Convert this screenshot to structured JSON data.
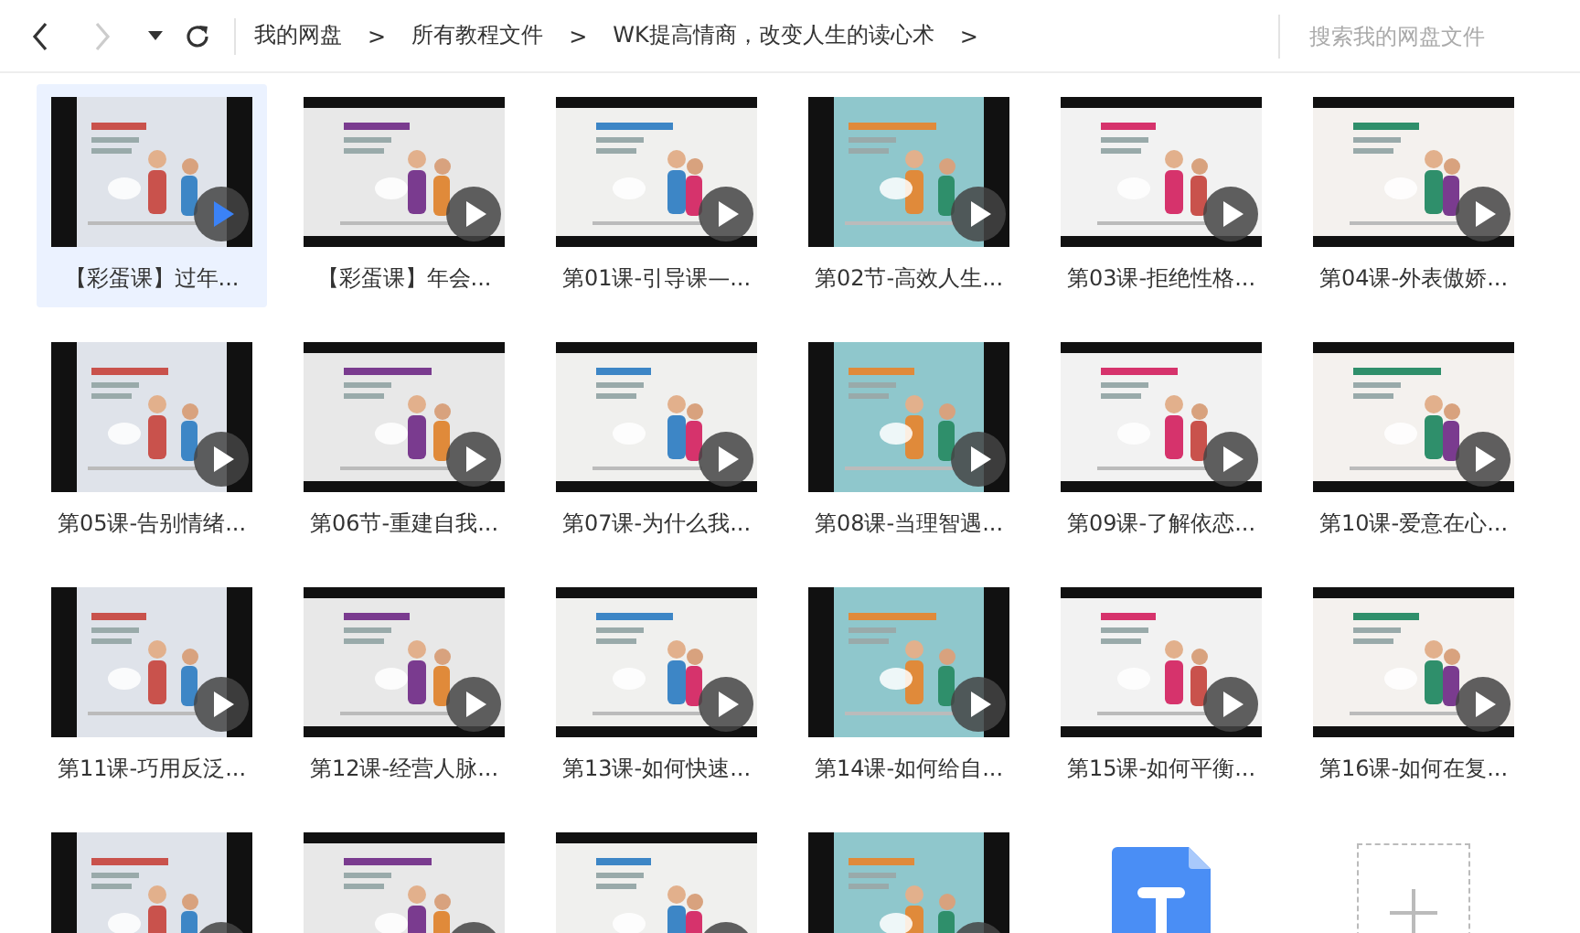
{
  "toolbar": {
    "nav": [
      {
        "kind": "back",
        "disabled": false
      },
      {
        "kind": "forward",
        "disabled": true
      },
      {
        "kind": "dropdown",
        "disabled": false
      },
      {
        "kind": "refresh",
        "disabled": false
      }
    ],
    "breadcrumbs": [
      {
        "label": "我的网盘",
        "sep": ">"
      },
      {
        "label": "所有教程文件",
        "sep": ">"
      },
      {
        "label": "WK提高情商，改变人生的读心术",
        "sep": ">"
      }
    ],
    "search": {
      "placeholder": "搜索我的网盘文件"
    }
  },
  "files": [
    {
      "kind": "video",
      "label": "【彩蛋课】过年...",
      "selected": true
    },
    {
      "kind": "video",
      "label": "【彩蛋课】年会...",
      "selected": false
    },
    {
      "kind": "video",
      "label": "第01课-引导课—...",
      "selected": false
    },
    {
      "kind": "video",
      "label": "第02节-高效人生...",
      "selected": false
    },
    {
      "kind": "video",
      "label": "第03课-拒绝性格...",
      "selected": false
    },
    {
      "kind": "video",
      "label": "第04课-外表傲娇...",
      "selected": false
    },
    {
      "kind": "video",
      "label": "第05课-告别情绪...",
      "selected": false
    },
    {
      "kind": "video",
      "label": "第06节-重建自我...",
      "selected": false
    },
    {
      "kind": "video",
      "label": "第07课-为什么我...",
      "selected": false
    },
    {
      "kind": "video",
      "label": "第08课-当理智遇...",
      "selected": false
    },
    {
      "kind": "video",
      "label": "第09课-了解依恋...",
      "selected": false
    },
    {
      "kind": "video",
      "label": "第10课-爱意在心...",
      "selected": false
    },
    {
      "kind": "video",
      "label": "第11课-巧用反泛...",
      "selected": false
    },
    {
      "kind": "video",
      "label": "第12课-经营人脉...",
      "selected": false
    },
    {
      "kind": "video",
      "label": "第13课-如何快速...",
      "selected": false
    },
    {
      "kind": "video",
      "label": "第14课-如何给自...",
      "selected": false
    },
    {
      "kind": "video",
      "label": "第15课-如何平衡...",
      "selected": false
    },
    {
      "kind": "video",
      "label": "第16课-如何在复...",
      "selected": false
    },
    {
      "kind": "video",
      "selected": false
    },
    {
      "kind": "video",
      "selected": false
    },
    {
      "kind": "video",
      "selected": false
    },
    {
      "kind": "video",
      "selected": false
    },
    {
      "kind": "document",
      "selected": false
    },
    {
      "kind": "add",
      "selected": false
    }
  ]
}
